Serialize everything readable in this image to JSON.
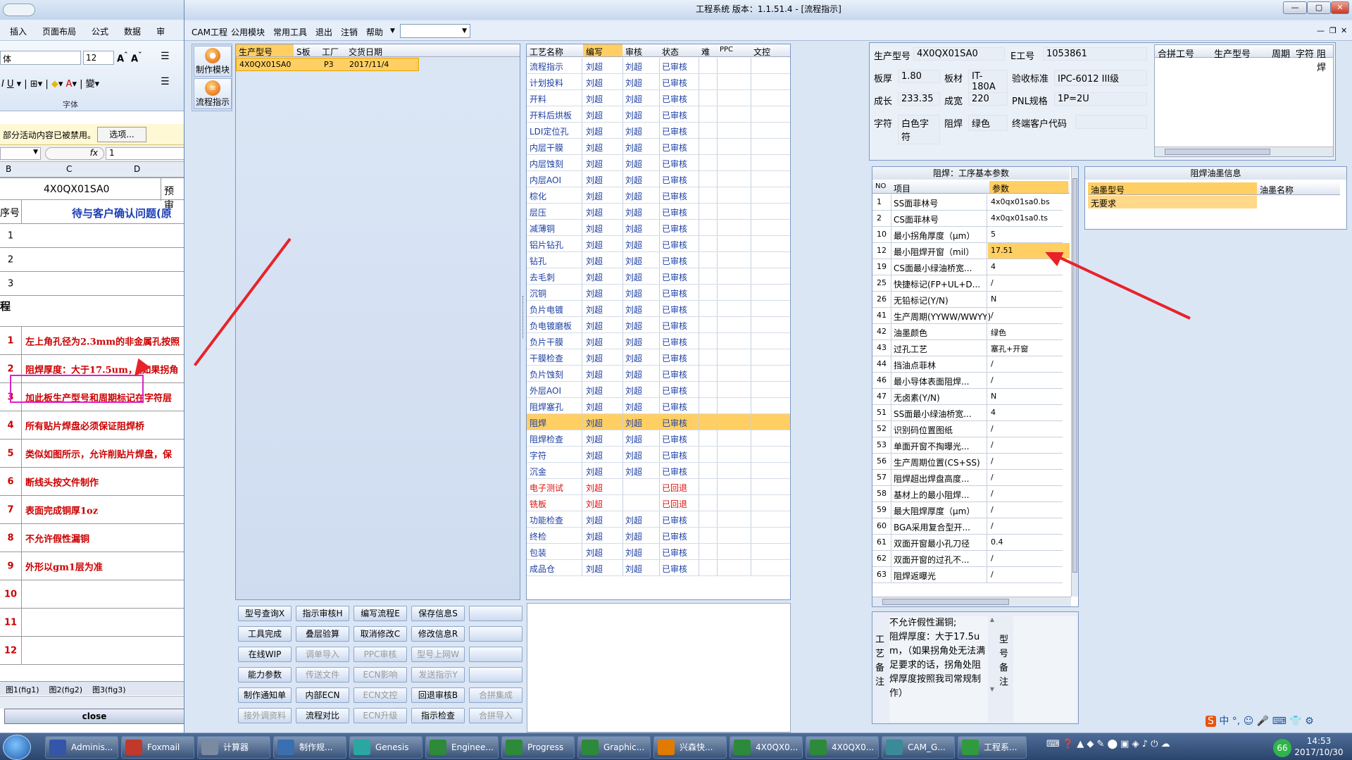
{
  "excel": {
    "menu": [
      "插入",
      "页面布局",
      "公式",
      "数据",
      "审"
    ],
    "font_name": "体",
    "font_size": "12",
    "font_group": "字体",
    "warning": "部分活动内容已被禁用。",
    "options_button": "选项...",
    "cell_ref": "",
    "fx": "fx",
    "formula_value": "1",
    "col_headers": [
      "B",
      "C",
      "D"
    ],
    "model": "4X0QX01SA0",
    "pre": "预审",
    "seq_header": "序号",
    "title": "待与客户确认问题(原",
    "blank_rows": [
      "1",
      "2",
      "3"
    ],
    "process_label": "程",
    "items": [
      {
        "n": "1",
        "t": "左上角孔径为2.3mm的非金属孔按照"
      },
      {
        "n": "2",
        "t": "阻焊厚度：大于17.5um，（如果拐角"
      },
      {
        "n": "3",
        "t": "加此板生产型号和周期标记在字符层"
      },
      {
        "n": "4",
        "t": "所有贴片焊盘必须保证阻焊桥"
      },
      {
        "n": "5",
        "t": "类似如图所示，允许削贴片焊盘，保"
      },
      {
        "n": "6",
        "t": "断线头按文件制作"
      },
      {
        "n": "7",
        "t": "表面完成铜厚1oz"
      },
      {
        "n": "8",
        "t": "不允许假性漏铜"
      },
      {
        "n": "9",
        "t": "外形以gm1层为准"
      },
      {
        "n": "10",
        "t": ""
      },
      {
        "n": "11",
        "t": ""
      },
      {
        "n": "12",
        "t": ""
      }
    ],
    "sheet_tabs": [
      "图1(fig1)",
      "图2(fig2)",
      "图3(fig3)"
    ],
    "close_label": "close"
  },
  "app": {
    "title": "工程系统  版本：1.1.51.4 - [流程指示]",
    "menu": [
      "CAM工程",
      "公用模块",
      "常用工具",
      "退出",
      "注销",
      "帮助"
    ],
    "side_buttons": [
      "制作模块",
      "流程指示"
    ],
    "model_headers": [
      "生产型号",
      "S板",
      "工厂",
      "交货日期"
    ],
    "model_row": [
      "4X0QX01SA0",
      "",
      "P3",
      "2017/11/4"
    ],
    "process_headers": [
      "工艺名称",
      "编写",
      "审核",
      "状态",
      "难",
      "PPC",
      "文控"
    ],
    "processes": [
      [
        "流程指示",
        "刘超",
        "刘超",
        "已审核"
      ],
      [
        "计划投料",
        "刘超",
        "刘超",
        "已审核"
      ],
      [
        "开料",
        "刘超",
        "刘超",
        "已审核"
      ],
      [
        "开料后烘板",
        "刘超",
        "刘超",
        "已审核"
      ],
      [
        "LDI定位孔",
        "刘超",
        "刘超",
        "已审核"
      ],
      [
        "内层干膜",
        "刘超",
        "刘超",
        "已审核"
      ],
      [
        "内层蚀刻",
        "刘超",
        "刘超",
        "已审核"
      ],
      [
        "内层AOI",
        "刘超",
        "刘超",
        "已审核"
      ],
      [
        "棕化",
        "刘超",
        "刘超",
        "已审核"
      ],
      [
        "层压",
        "刘超",
        "刘超",
        "已审核"
      ],
      [
        "减薄铜",
        "刘超",
        "刘超",
        "已审核"
      ],
      [
        "铝片钻孔",
        "刘超",
        "刘超",
        "已审核"
      ],
      [
        "钻孔",
        "刘超",
        "刘超",
        "已审核"
      ],
      [
        "去毛刺",
        "刘超",
        "刘超",
        "已审核"
      ],
      [
        "沉铜",
        "刘超",
        "刘超",
        "已审核"
      ],
      [
        "负片电镀",
        "刘超",
        "刘超",
        "已审核"
      ],
      [
        "负电镀磨板",
        "刘超",
        "刘超",
        "已审核"
      ],
      [
        "负片干膜",
        "刘超",
        "刘超",
        "已审核"
      ],
      [
        "干膜检查",
        "刘超",
        "刘超",
        "已审核"
      ],
      [
        "负片蚀刻",
        "刘超",
        "刘超",
        "已审核"
      ],
      [
        "外层AOI",
        "刘超",
        "刘超",
        "已审核"
      ],
      [
        "阻焊塞孔",
        "刘超",
        "刘超",
        "已审核"
      ],
      [
        "阻焊",
        "刘超",
        "刘超",
        "已审核"
      ],
      [
        "阻焊检查",
        "刘超",
        "刘超",
        "已审核"
      ],
      [
        "字符",
        "刘超",
        "刘超",
        "已审核"
      ],
      [
        "沉金",
        "刘超",
        "刘超",
        "已审核"
      ],
      [
        "电子测试",
        "刘超",
        "",
        "已回退"
      ],
      [
        "铣板",
        "刘超",
        "",
        "已回退"
      ],
      [
        "功能检查",
        "刘超",
        "刘超",
        "已审核"
      ],
      [
        "终检",
        "刘超",
        "刘超",
        "已审核"
      ],
      [
        "包装",
        "刘超",
        "刘超",
        "已审核"
      ],
      [
        "成品仓",
        "刘超",
        "刘超",
        "已审核"
      ]
    ],
    "buttons": [
      [
        "型号查询X",
        "指示审核H",
        "编写流程E",
        "保存信息S",
        ""
      ],
      [
        "工具完成",
        "叠层验算",
        "取消修改C",
        "修改信息R",
        ""
      ],
      [
        "在线WIP",
        "调单导入",
        "PPC审核",
        "型号上网W",
        ""
      ],
      [
        "能力参数",
        "传送文件",
        "ECN影响",
        "发送指示Y",
        ""
      ],
      [
        "制作通知单",
        "内部ECN",
        "ECN文控",
        "回退审核B",
        "合拼集成"
      ],
      [
        "接外调资料",
        "流程对比",
        "ECN升级",
        "指示检查",
        "合拼导入"
      ]
    ],
    "info": {
      "model_label": "生产型号",
      "model": "4X0QX01SA0",
      "eng_label": "E工号",
      "eng": "1053861",
      "thick_label": "板厚",
      "thick": "1.80",
      "mat_label": "板材",
      "mat": "IT-180A",
      "std_label": "验收标准",
      "std": "IPC-6012 III级",
      "len_label": "成长",
      "len": "233.35",
      "wid_label": "成宽",
      "wid": "220",
      "pnl_label": "PNL规格",
      "pnl": "1P=2U",
      "char_label": "字符",
      "char": "白色字符",
      "mask_label": "阻焊",
      "mask": "绿色",
      "cust_label": "终端客户代码",
      "cust": ""
    },
    "merge_headers": [
      "合拼工号",
      "生产型号",
      "周期",
      "字符",
      "阻焊"
    ],
    "param_title": "阻焊：工序基本参数",
    "param_headers": [
      "NO",
      "项目",
      "参数"
    ],
    "params": [
      [
        "1",
        "SS面菲林号",
        "4x0qx01sa0.bs"
      ],
      [
        "2",
        "CS面菲林号",
        "4x0qx01sa0.ts"
      ],
      [
        "10",
        "最小拐角厚度（μm）",
        "5"
      ],
      [
        "12",
        "最小阻焊开窗（mil）",
        "17.51"
      ],
      [
        "19",
        "CS面最小绿油桥宽...",
        "4"
      ],
      [
        "25",
        "快捷标记(FP+UL+D...",
        "/"
      ],
      [
        "26",
        "无铅标记(Y/N)",
        "N"
      ],
      [
        "41",
        "生产周期(YYWW/WWYY)",
        "/"
      ],
      [
        "42",
        "油墨颜色",
        "绿色"
      ],
      [
        "43",
        "过孔工艺",
        "塞孔+开窗"
      ],
      [
        "44",
        "挡油点菲林",
        "/"
      ],
      [
        "46",
        "最小导体表面阻焊...",
        "/"
      ],
      [
        "47",
        "无卤素(Y/N)",
        "N"
      ],
      [
        "51",
        "SS面最小绿油桥宽...",
        "4"
      ],
      [
        "52",
        "识别码位置图纸",
        "/"
      ],
      [
        "53",
        "单面开窗不掏曝光...",
        "/"
      ],
      [
        "56",
        "生产周期位置(CS+SS)",
        "/"
      ],
      [
        "57",
        "阻焊超出焊盘高度...",
        "/"
      ],
      [
        "58",
        "基材上的最小阻焊...",
        "/"
      ],
      [
        "59",
        "最大阻焊厚度（μm）",
        "/"
      ],
      [
        "60",
        "BGA采用复合型开...",
        "/"
      ],
      [
        "61",
        "双面开窗最小孔刀径",
        "0.4"
      ],
      [
        "62",
        "双面开窗的过孔不...",
        "/"
      ],
      [
        "63",
        "阻焊返曝光",
        "/"
      ]
    ],
    "ink_title": "阻焊油墨信息",
    "ink_headers": [
      "油墨型号",
      "油墨名称"
    ],
    "ink_row": [
      "无要求",
      ""
    ],
    "process_note_label": "工艺备注",
    "process_note": "不允许假性漏铜;\n阻焊厚度：大于17.5um，（如果拐角处无法满足要求的话，拐角处阻焊厚度按照我司常规制作）",
    "model_note_label": "型号备注"
  },
  "taskbar": {
    "items": [
      "Adminis...",
      "Foxmail",
      "计算器",
      "制作规...",
      "Genesis",
      "Enginee...",
      "Progress",
      "Graphic...",
      "兴森快...",
      "4X0QX0...",
      "4X0QX0...",
      "CAM_G...",
      "工程系..."
    ],
    "badge": "66",
    "time": "14:53",
    "date": "2017/10/30"
  }
}
